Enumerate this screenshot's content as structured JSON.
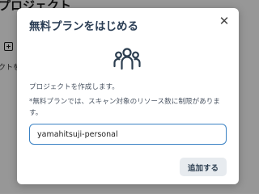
{
  "background": {
    "page_title": "プロジェクト",
    "add_label": "クトを"
  },
  "dialog": {
    "title": "無料プランをはじめる",
    "close_glyph": "✕",
    "icon": "users-group-icon",
    "description": "プロジェクトを作成します。",
    "note": "*無料プランでは、スキャン対象のリソース数に制限があります。",
    "project_name_value": "yamahitsuji-personal",
    "submit_label": "追加する"
  },
  "colors": {
    "title": "#2b3e55",
    "input_border": "#3b82c4",
    "button_bg": "#e7ebef",
    "icon_stroke": "#2c3e50"
  }
}
